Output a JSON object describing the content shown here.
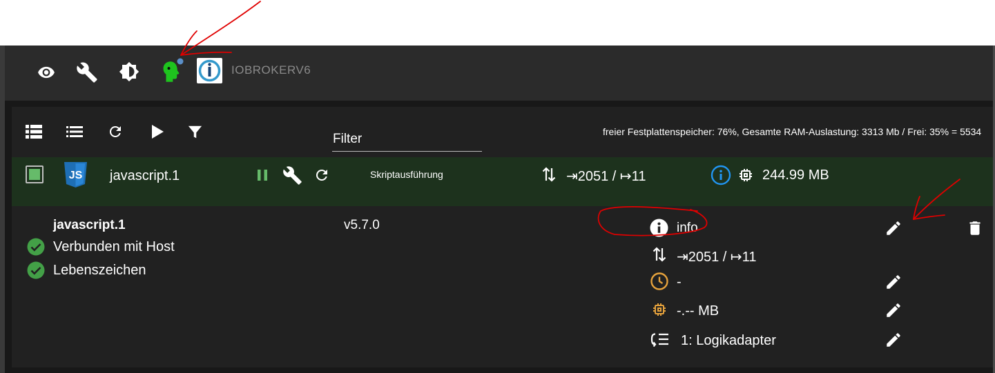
{
  "toolbar": {
    "brand": "IOBROKERV6",
    "icons": [
      "eye-icon",
      "wrench-icon",
      "brightness-icon",
      "expert-mode-icon",
      "iobroker-logo"
    ]
  },
  "list_toolbar": {
    "icons": [
      "list-view-icon",
      "compact-list-icon",
      "reload-icon",
      "play-icon",
      "filter-icon"
    ],
    "filter_label": "Filter",
    "status": "freier Festplattenspeicher: 76%, Gesamte RAM-Auslastung: 3313 Mb / Frei: 35% = 5534"
  },
  "adapter": {
    "name": "javascript.1",
    "mode": "Skriptausführung",
    "events": "⇥2051 / ↦11",
    "memory": "244.99 MB",
    "checked": true
  },
  "details": {
    "title": "javascript.1",
    "connected": "Verbunden mit Host",
    "alive": "Lebenszeichen",
    "version": "v5.7.0",
    "info": "info",
    "events": "⇥2051 / ↦11",
    "schedule": "-",
    "ram_limit": "-.-- MB",
    "tier": "1: Logikadapter"
  },
  "colors": {
    "accent_green": "#66bb6a",
    "row_green": "#1d321d",
    "info_blue": "#2196f3",
    "warning_orange": "#e6a23c",
    "annotation_red": "#e00000"
  }
}
